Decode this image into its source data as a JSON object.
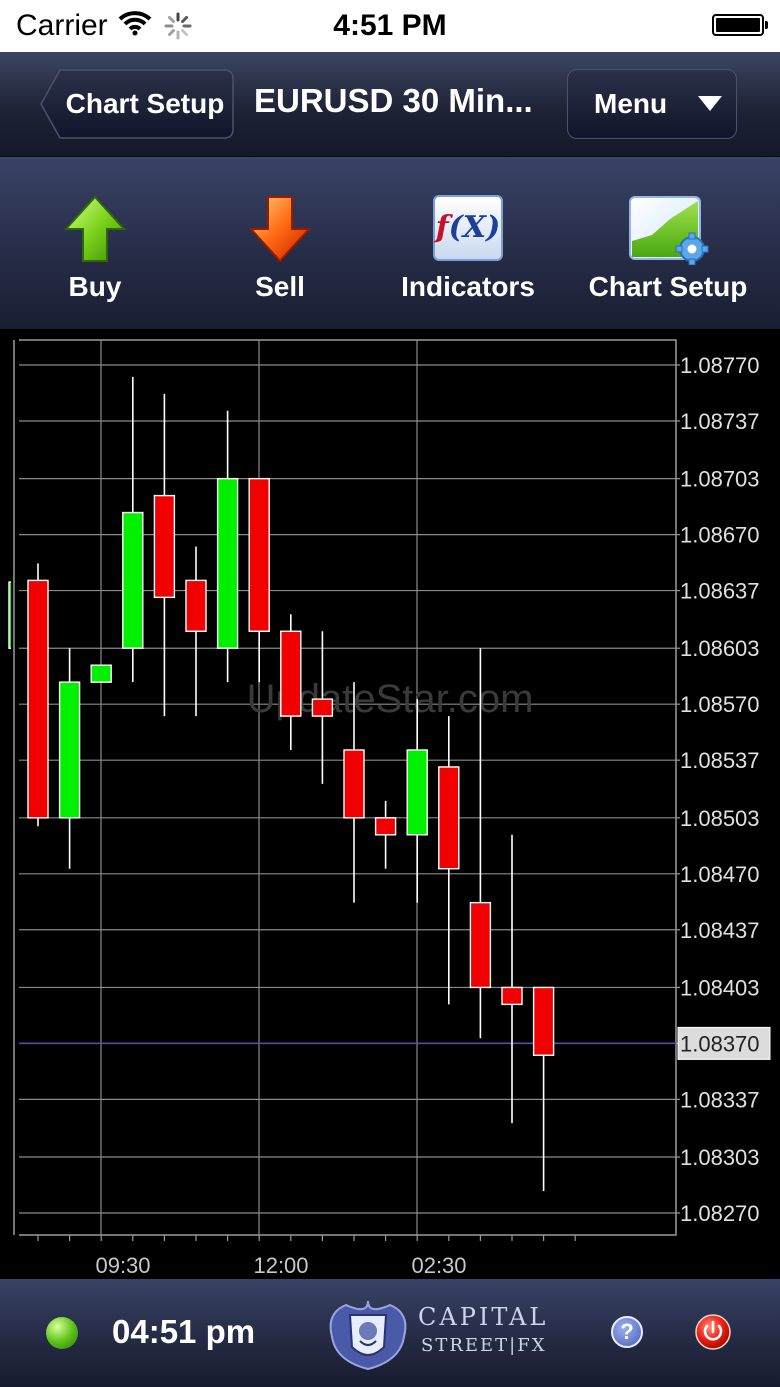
{
  "status_bar": {
    "carrier": "Carrier",
    "time": "4:51 PM"
  },
  "nav": {
    "back_label": "Chart Setup",
    "title": "EURUSD 30 Min...",
    "menu_label": "Menu"
  },
  "toolbar": {
    "buy_label": "Buy",
    "sell_label": "Sell",
    "indicators_label": "Indicators",
    "indicators_icon_text_f": "f",
    "indicators_icon_text_x": "(X)",
    "chart_setup_label": "Chart Setup"
  },
  "chart_data": {
    "type": "candlestick",
    "symbol": "EURUSD",
    "timeframe": "30 Min",
    "y_ticks": [
      "1.08770",
      "1.08737",
      "1.08703",
      "1.08670",
      "1.08637",
      "1.08603",
      "1.08570",
      "1.08537",
      "1.08503",
      "1.08470",
      "1.08437",
      "1.08403",
      "1.08370",
      "1.08337",
      "1.08303",
      "1.08270"
    ],
    "ylim": [
      1.0826,
      1.0878
    ],
    "x_ticks": [
      "09:30",
      "12:00",
      "02:30"
    ],
    "current_price": "1.08370",
    "watermark": "UpdateStar.com",
    "bull_color": "#00f000",
    "bear_color": "#f00000",
    "candles": [
      {
        "open": 1.08603,
        "close": 1.08642,
        "high": 1.08642,
        "low": 1.08603,
        "dir": "up"
      },
      {
        "open": 1.08643,
        "close": 1.08503,
        "high": 1.08653,
        "low": 1.08498,
        "dir": "down"
      },
      {
        "open": 1.08503,
        "close": 1.08583,
        "high": 1.08603,
        "low": 1.08473,
        "dir": "up"
      },
      {
        "open": 1.08583,
        "close": 1.08593,
        "high": 1.08593,
        "low": 1.08583,
        "dir": "up"
      },
      {
        "open": 1.08603,
        "close": 1.08683,
        "high": 1.08763,
        "low": 1.08583,
        "dir": "up"
      },
      {
        "open": 1.08693,
        "close": 1.08633,
        "high": 1.08753,
        "low": 1.08563,
        "dir": "down"
      },
      {
        "open": 1.08643,
        "close": 1.08613,
        "high": 1.08663,
        "low": 1.08563,
        "dir": "down"
      },
      {
        "open": 1.08603,
        "close": 1.08703,
        "high": 1.08743,
        "low": 1.08583,
        "dir": "up"
      },
      {
        "open": 1.08703,
        "close": 1.08613,
        "high": 1.08703,
        "low": 1.08583,
        "dir": "down"
      },
      {
        "open": 1.08613,
        "close": 1.08563,
        "high": 1.08623,
        "low": 1.08543,
        "dir": "down"
      },
      {
        "open": 1.08573,
        "close": 1.08563,
        "high": 1.08613,
        "low": 1.08523,
        "dir": "down"
      },
      {
        "open": 1.08543,
        "close": 1.08503,
        "high": 1.08583,
        "low": 1.08453,
        "dir": "down"
      },
      {
        "open": 1.08503,
        "close": 1.08493,
        "high": 1.08513,
        "low": 1.08473,
        "dir": "down"
      },
      {
        "open": 1.08493,
        "close": 1.08543,
        "high": 1.08573,
        "low": 1.08453,
        "dir": "up"
      },
      {
        "open": 1.08533,
        "close": 1.08473,
        "high": 1.08563,
        "low": 1.08393,
        "dir": "down"
      },
      {
        "open": 1.08453,
        "close": 1.08403,
        "high": 1.08603,
        "low": 1.08373,
        "dir": "down"
      },
      {
        "open": 1.08403,
        "close": 1.08393,
        "high": 1.08493,
        "low": 1.08323,
        "dir": "down"
      },
      {
        "open": 1.08403,
        "close": 1.08363,
        "high": 1.08403,
        "low": 1.08283,
        "dir": "down"
      }
    ]
  },
  "bottom_bar": {
    "time": "04:51 pm",
    "logo_line1": "CAPITAL",
    "logo_line2": "STREET|FX"
  }
}
